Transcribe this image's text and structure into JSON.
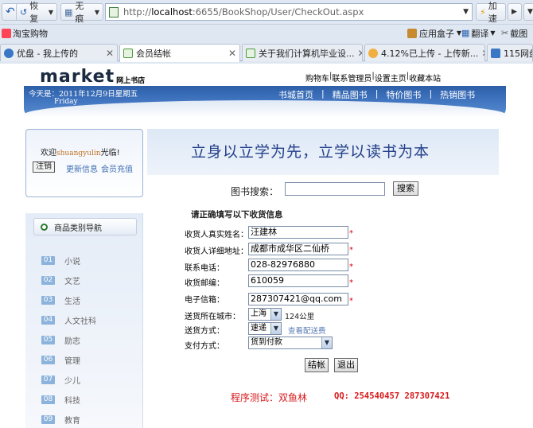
{
  "browser": {
    "back_label": "",
    "restore_label": "恢复",
    "noframe_label": "无痕",
    "address": {
      "host": "localhost",
      "rest": ":6655/BookShop/User/CheckOut.aspx",
      "scheme": "http://"
    },
    "accelerate_label": "加速",
    "bookmark": "淘宝购物",
    "tools": {
      "appbox": "应用盒子",
      "translate": "翻译",
      "screenshot": "截图"
    },
    "tabs": [
      {
        "label": "优盘 - 我上传的",
        "color": "#3a78c6"
      },
      {
        "label": "会员结帐",
        "color": "#4a9a3a"
      },
      {
        "label": "关于我们计算机毕业设...",
        "color": "#4a9a3a"
      },
      {
        "label": "4.12%已上传 - 上传新...",
        "color": "#e8a030"
      },
      {
        "label": "115网盘",
        "color": "#3a78c6"
      }
    ]
  },
  "site": {
    "logo": "market",
    "logo_sub": "网上书店",
    "top_links": [
      "购物车",
      "联系管理员",
      "设置主页",
      "收藏本站"
    ],
    "date_line1": "今天是：2011年12月9日星期五",
    "date_line2": "Friday",
    "menu": [
      "书城首页",
      "精品图书",
      "特价图书",
      "热销图书"
    ],
    "welcome_prefix": "欢迎",
    "username": "shuangyulin",
    "welcome_suffix": "光临!",
    "logout": "注销",
    "update_info": "更新信息",
    "recharge": "会员充值",
    "banner_text": "立身以立学为先，立学以读书为本",
    "search_label": "图书搜索：",
    "search_value": "",
    "search_button": "搜索",
    "category_title": "商品类别导航",
    "categories": [
      {
        "num": "01",
        "name": "小说"
      },
      {
        "num": "02",
        "name": "文艺"
      },
      {
        "num": "03",
        "name": "生活"
      },
      {
        "num": "04",
        "name": "人文社科"
      },
      {
        "num": "05",
        "name": "励志"
      },
      {
        "num": "06",
        "name": "管理"
      },
      {
        "num": "07",
        "name": "少儿"
      },
      {
        "num": "08",
        "name": "科技"
      },
      {
        "num": "09",
        "name": "教育"
      }
    ]
  },
  "form": {
    "heading": "请正确填写以下收货信息",
    "name_label": "收货人真实姓名：",
    "name_value": "汪建林",
    "addr_label": "收货人详细地址：",
    "addr_value": "成都市成华区二仙桥",
    "phone_label": "联系电话：",
    "phone_value": "028-82976880",
    "zip_label": "收货邮编：",
    "zip_value": "610059",
    "email_label": "电子信箱：",
    "email_value": "287307421@qq.com",
    "required_mark": "*",
    "city_label": "送货所在城市：",
    "city_value": "上海",
    "distance": "124公里",
    "ship_label": "送货方式：",
    "ship_value": "速递",
    "view_ship": "查看配送费",
    "pay_label": "支付方式：",
    "pay_value": "货到付款",
    "checkout": "结帐",
    "exit": "退出"
  },
  "footer": {
    "tester": "程序测试：双鱼林",
    "qq": "QQ: 254540457 287307421"
  }
}
